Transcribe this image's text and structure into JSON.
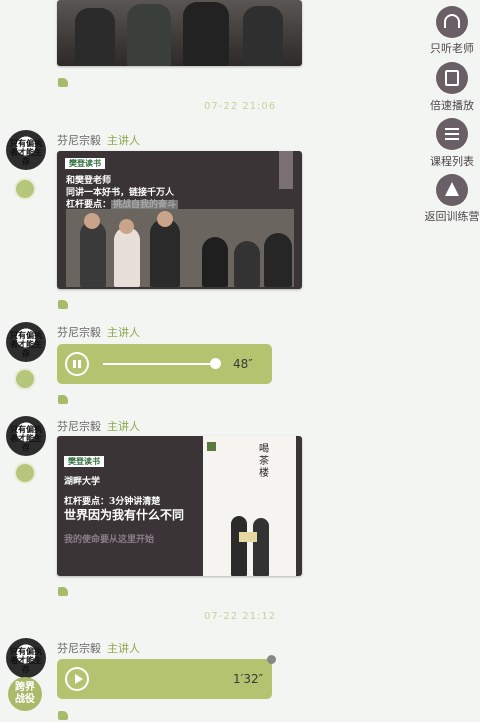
{
  "sidebar": {
    "items": [
      {
        "label": "只听老师",
        "icon": "headphones-icon"
      },
      {
        "label": "倍速播放",
        "icon": "speed-icon"
      },
      {
        "label": "课程列表",
        "icon": "list-icon"
      },
      {
        "label": "返回训练营",
        "icon": "back-icon"
      }
    ]
  },
  "timestamps": [
    "07-22 21:06",
    "07-22 21:12"
  ],
  "speaker": {
    "name": "芬尼宗毅",
    "role": "主讲人",
    "avatar_text": "只有偏执者才能生存"
  },
  "card1": {
    "logo": "樊登读书",
    "line1": "和樊登老师",
    "line2": "同讲一本好书，链接千万人",
    "line3": "杠杆要点：",
    "line3_highlight": "挑战自我的奋斗"
  },
  "voice1": {
    "duration": "48″"
  },
  "card2": {
    "logo": "樊登读书",
    "school": "湖畔大学",
    "subtitle": "杠杆要点：3分钟讲清楚",
    "title": "世界因为我有什么不同",
    "footer": "我的使命要从这里开始",
    "calligraphy": "喝茶楼"
  },
  "voice2": {
    "duration": "1′32″"
  },
  "badge_text": "跨界战役",
  "colors": {
    "accent": "#8fa84e",
    "voice": "#b4c36f",
    "card": "#3a3437"
  }
}
